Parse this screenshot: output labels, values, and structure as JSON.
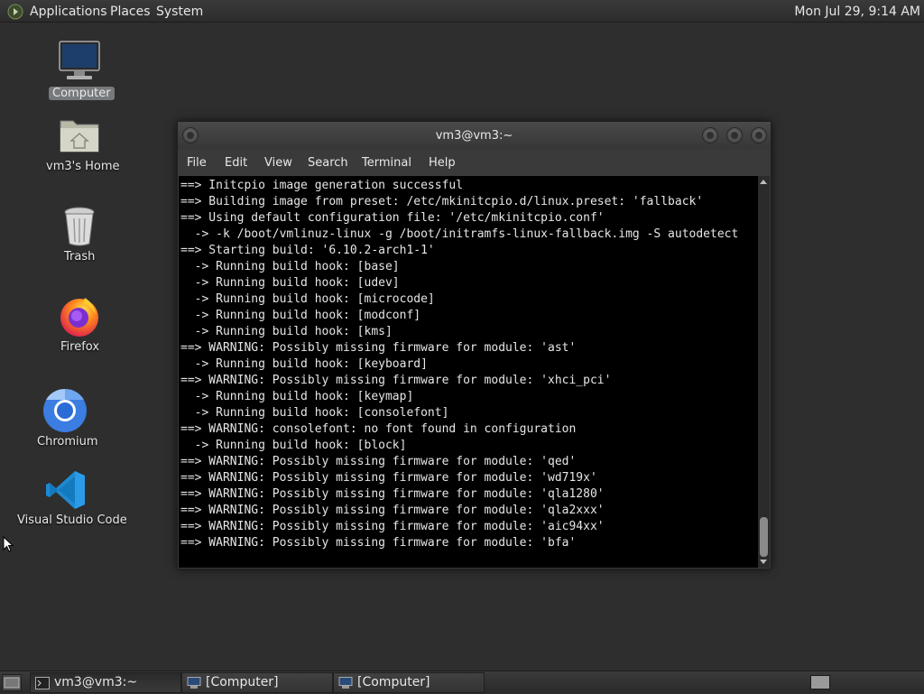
{
  "top_panel": {
    "menus": [
      "Applications",
      "Places",
      "System"
    ],
    "clock": "Mon Jul 29,  9:14 AM"
  },
  "desktop_icons": [
    {
      "label": "Computer",
      "icon": "computer-icon"
    },
    {
      "label": "vm3's Home",
      "icon": "home-folder-icon"
    },
    {
      "label": "Trash",
      "icon": "trash-icon"
    },
    {
      "label": "Firefox",
      "icon": "firefox-icon"
    },
    {
      "label": "Chromium",
      "icon": "chromium-icon"
    },
    {
      "label": "Visual Studio Code",
      "icon": "vscode-icon"
    }
  ],
  "terminal": {
    "title": "vm3@vm3:~",
    "menus": [
      "File",
      "Edit",
      "View",
      "Search",
      "Terminal",
      "Help"
    ],
    "lines": [
      "==> Initcpio image generation successful",
      "==> Building image from preset: /etc/mkinitcpio.d/linux.preset: 'fallback'",
      "==> Using default configuration file: '/etc/mkinitcpio.conf'",
      "  -> -k /boot/vmlinuz-linux -g /boot/initramfs-linux-fallback.img -S autodetect",
      "==> Starting build: '6.10.2-arch1-1'",
      "  -> Running build hook: [base]",
      "  -> Running build hook: [udev]",
      "  -> Running build hook: [microcode]",
      "  -> Running build hook: [modconf]",
      "  -> Running build hook: [kms]",
      "==> WARNING: Possibly missing firmware for module: 'ast'",
      "  -> Running build hook: [keyboard]",
      "==> WARNING: Possibly missing firmware for module: 'xhci_pci'",
      "  -> Running build hook: [keymap]",
      "  -> Running build hook: [consolefont]",
      "==> WARNING: consolefont: no font found in configuration",
      "  -> Running build hook: [block]",
      "==> WARNING: Possibly missing firmware for module: 'qed'",
      "==> WARNING: Possibly missing firmware for module: 'wd719x'",
      "==> WARNING: Possibly missing firmware for module: 'qla1280'",
      "==> WARNING: Possibly missing firmware for module: 'qla2xxx'",
      "==> WARNING: Possibly missing firmware for module: 'aic94xx'",
      "==> WARNING: Possibly missing firmware for module: 'bfa'"
    ]
  },
  "taskbar": {
    "tasks": [
      {
        "label": "vm3@vm3:~",
        "icon": "terminal-icon"
      },
      {
        "label": "[Computer]",
        "icon": "computer-icon"
      },
      {
        "label": "[Computer]",
        "icon": "computer-icon"
      }
    ]
  },
  "colors": {
    "desktop_bg": "#2e2e2e",
    "panel_bg": "#333333",
    "terminal_bg": "#000000",
    "terminal_fg": "#e6e6e6",
    "selected_label_bg": "#777a7d"
  }
}
